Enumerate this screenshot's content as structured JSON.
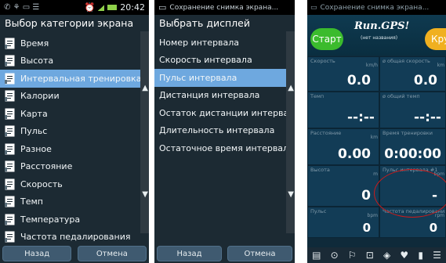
{
  "panel1": {
    "status_time": "20:42",
    "title": "Выбор категории экрана",
    "items": [
      {
        "label": "Время"
      },
      {
        "label": "Высота"
      },
      {
        "label": "Интервальная тренировка",
        "selected": true
      },
      {
        "label": "Калории"
      },
      {
        "label": "Карта"
      },
      {
        "label": "Пульс"
      },
      {
        "label": "Разное"
      },
      {
        "label": "Расстояние"
      },
      {
        "label": "Скорость"
      },
      {
        "label": "Темп"
      },
      {
        "label": "Температура"
      },
      {
        "label": "Частота педалирования"
      }
    ],
    "back_label": "Назад",
    "cancel_label": "Отмена"
  },
  "panel2": {
    "status_text": "Сохранение снимка экрана...",
    "title": "Выбрать дисплей",
    "items": [
      {
        "label": "Номер интервала"
      },
      {
        "label": "Скорость интервала"
      },
      {
        "label": "Пульс интервала",
        "selected": true
      },
      {
        "label": "Дистанция интервала"
      },
      {
        "label": "Остаток дистанции интервала"
      },
      {
        "label": "Длительность интервала"
      },
      {
        "label": "Остаточное время интервала"
      }
    ],
    "back_label": "Назад",
    "cancel_label": "Отмена"
  },
  "panel3": {
    "status_text": "Сохранение снимка экрана...",
    "start_label": "Старт",
    "stop_label": "Круг",
    "logo_text": "Run.GPS!",
    "logo_sub": "(нет названия)",
    "cells": [
      {
        "label": "Скорость",
        "value": "0.0",
        "unit": "km/h"
      },
      {
        "label": "ø общая скорость",
        "value": "0.0",
        "unit": "km"
      },
      {
        "label": "Темп",
        "value": "--:--",
        "unit": ""
      },
      {
        "label": "ø общий темп",
        "value": "--:--",
        "unit": ""
      },
      {
        "label": "Расстояние",
        "value": "0.00",
        "unit": "km"
      },
      {
        "label": "Время тренировки",
        "value": "0:00:00",
        "unit": ""
      },
      {
        "label": "Высота",
        "value": "0",
        "unit": "m"
      },
      {
        "label": "Пульс интервала #1",
        "value": "-",
        "unit": "bpm"
      },
      {
        "label": "Пульс",
        "value": "0",
        "unit": "bpm"
      },
      {
        "label": "Частота педалирования",
        "value": "0",
        "unit": "rpm"
      }
    ]
  }
}
